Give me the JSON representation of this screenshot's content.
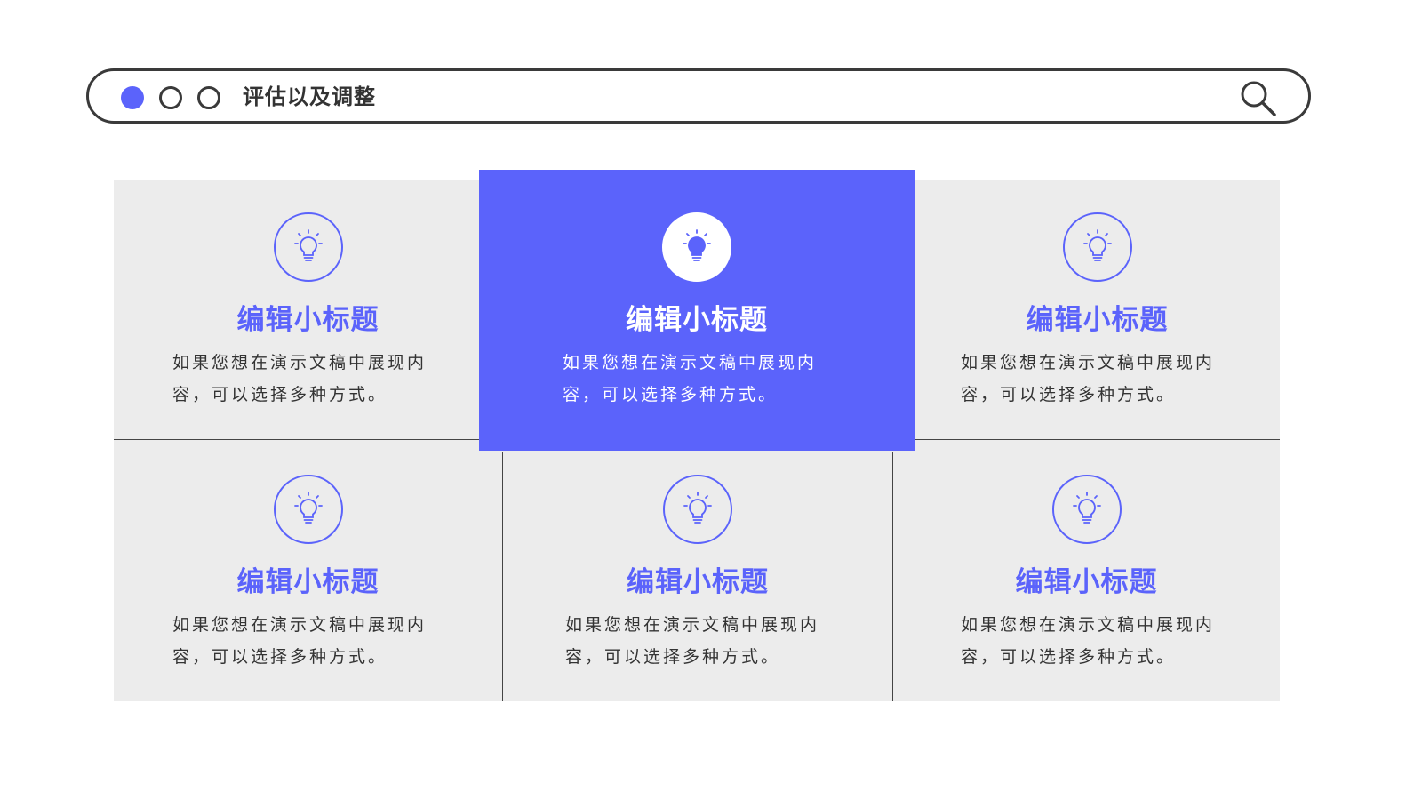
{
  "window": {
    "title": "评估以及调整",
    "colors": {
      "accent": "#5b63fb",
      "card_bg": "#ececec",
      "dark": "#3a3a3a"
    },
    "icons": {
      "search": "search-icon",
      "card": "lightbulb-icon"
    }
  },
  "cards": [
    {
      "title": "编辑小标题",
      "desc_line1": "如果您想在演示文稿中展现内",
      "desc_line2": "容，可以选择多种方式。"
    },
    {
      "title": "编辑小标题",
      "desc_line1": "如果您想在演示文稿中展现内",
      "desc_line2": "容，可以选择多种方式。",
      "highlighted": true
    },
    {
      "title": "编辑小标题",
      "desc_line1": "如果您想在演示文稿中展现内",
      "desc_line2": "容，可以选择多种方式。"
    },
    {
      "title": "编辑小标题",
      "desc_line1": "如果您想在演示文稿中展现内",
      "desc_line2": "容，可以选择多种方式。"
    },
    {
      "title": "编辑小标题",
      "desc_line1": "如果您想在演示文稿中展现内",
      "desc_line2": "容，可以选择多种方式。"
    },
    {
      "title": "编辑小标题",
      "desc_line1": "如果您想在演示文稿中展现内",
      "desc_line2": "容，可以选择多种方式。"
    }
  ]
}
